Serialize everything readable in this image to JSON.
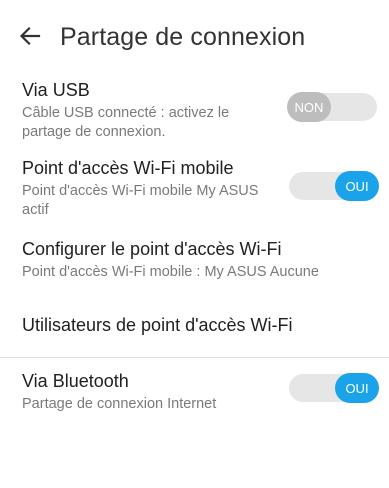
{
  "header": {
    "title": "Partage de connexion",
    "back_icon": "arrow-left-icon"
  },
  "settings": [
    {
      "title": "Via USB",
      "subtitle": "Câble USB connecté : activez le partage de connexion.",
      "toggle": {
        "state": "off",
        "label": "NON"
      }
    },
    {
      "title": "Point d'accès Wi-Fi mobile",
      "subtitle": "Point d'accès Wi-Fi mobile My ASUS actif",
      "toggle": {
        "state": "on",
        "label": "OUI"
      }
    },
    {
      "title": "Configurer le point d'accès Wi-Fi",
      "subtitle": "Point d'accès Wi-Fi mobile : My ASUS Aucune"
    },
    {
      "title": "Utilisateurs de point d'accès Wi-Fi"
    },
    {
      "title": "Via Bluetooth",
      "subtitle": "Partage de connexion Internet",
      "toggle": {
        "state": "on",
        "label": "OUI"
      }
    }
  ],
  "colors": {
    "accent": "#1aa3e8",
    "toggle_off": "#bdbdbd",
    "track": "#e6e6e6",
    "text_primary": "#212121",
    "text_secondary": "#7a7a7a"
  }
}
